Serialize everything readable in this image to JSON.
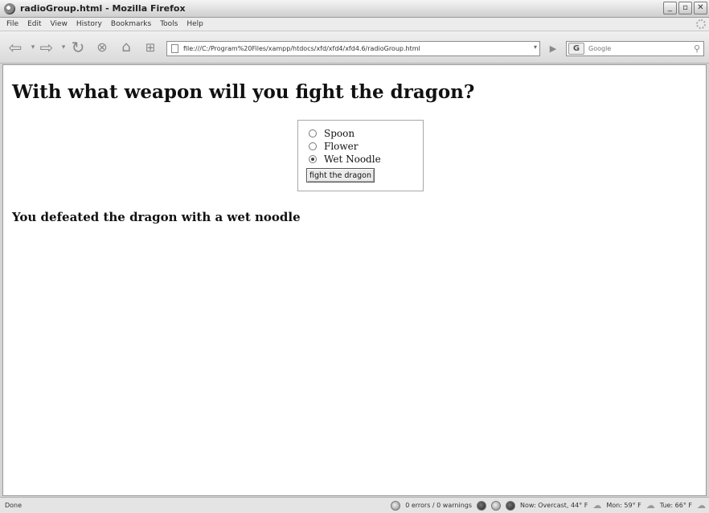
{
  "window": {
    "title": "radioGroup.html - Mozilla Firefox",
    "controls": [
      "_",
      "▫",
      "✕"
    ]
  },
  "menu": [
    "File",
    "Edit",
    "View",
    "History",
    "Bookmarks",
    "Tools",
    "Help"
  ],
  "navbar": {
    "url": "file:///C:/Program%20Files/xampp/htdocs/xfd/xfd4/xfd4.6/radioGroup.html",
    "search_placeholder": "Google",
    "search_engine_label": "G"
  },
  "page": {
    "heading": "With what weapon will you fight the dragon?",
    "options": [
      {
        "label": "Spoon",
        "checked": false
      },
      {
        "label": "Flower",
        "checked": false
      },
      {
        "label": "Wet Noodle",
        "checked": true
      }
    ],
    "button_label": "fight the dragon",
    "result": "You defeated the dragon with a wet noodle"
  },
  "status": {
    "left": "Done",
    "errors": "0 errors / 0 warnings",
    "weather_now": "Now: Overcast, 44° F",
    "weather_mon": "Mon: 59° F",
    "weather_tue": "Tue: 66° F"
  }
}
